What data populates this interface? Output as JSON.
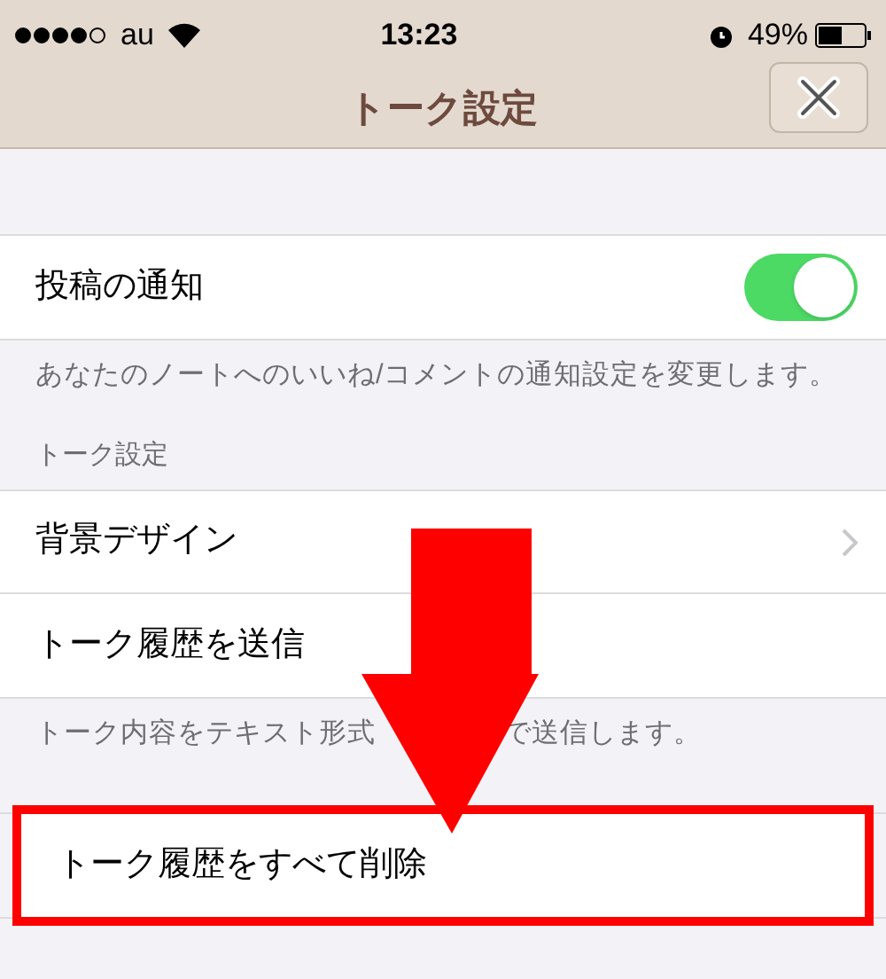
{
  "status_bar": {
    "carrier": "au",
    "time": "13:23",
    "battery": "49%"
  },
  "nav": {
    "title": "トーク設定"
  },
  "sections": [
    {
      "rows": [
        {
          "kind": "toggle",
          "label": "投稿の通知",
          "on": true
        }
      ],
      "footer": [
        "あなたのノートへのいいね/コメントの通知設定を変更します。"
      ]
    },
    {
      "header": "トーク設定",
      "rows": [
        {
          "kind": "link",
          "label": "背景デザイン"
        },
        {
          "kind": "plain",
          "label": "トーク履歴を送信"
        }
      ],
      "footer": [
        "トーク内容をテキスト形式",
        "で送信します。"
      ]
    },
    {
      "rows": [
        {
          "kind": "plain",
          "label": "トーク履歴をすべて削除",
          "highlighted": true
        }
      ]
    }
  ]
}
